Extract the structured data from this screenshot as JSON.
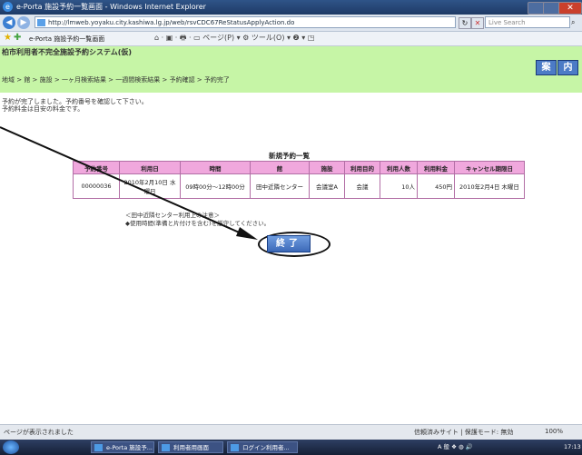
{
  "window": {
    "title": "e-Porta 施設予約一覧画面 - Windows Internet Explorer",
    "ie_icon": "e",
    "close": "✕"
  },
  "addressbar": {
    "url": "http://lmweb.yoyaku.city.kashiwa.lg.jp/web/rsvCDC67ReStatusApplyAction.do",
    "search_placeholder": "Live Search",
    "refresh": "↻",
    "stop": "✕",
    "back_icon": "◀",
    "forward_icon": "▶"
  },
  "toolbar": {
    "tab_title": "e-Porta 施設予約一覧画面",
    "home_label": "⌂ · ▣ · 🖶 · ▭ ページ(P) ▾ ⚙ ツール(O) ▾ ❷ ▾ ◳"
  },
  "page": {
    "site_title": "柏市利用者不完全施設予約システム(仮)",
    "home_button": "案",
    "guide_button": "内",
    "breadcrumb": "地域 > 館 > 施設 > 一ヶ月検索結果 > 一週間検索結果 > 予約確認 > 予約完了",
    "message_1": "予約が完了しました。予約番号を確認して下さい。",
    "message_2": "予約料金は目安の料金です。",
    "list_title": "新規予約一覧",
    "table": {
      "headers": [
        "予約番号",
        "利用日",
        "時間",
        "館",
        "施設",
        "利用目的",
        "利用人数",
        "利用料金",
        "キャンセル期限日"
      ],
      "rows": [
        [
          "00000036",
          "2010年2月10日 水曜日",
          "09時00分〜12時00分",
          "田中近隣センター",
          "会議室A",
          "会議",
          "10人",
          "450円",
          "2010年2月4日 木曜日"
        ]
      ]
    },
    "note_1": "＜田中近隣センター利用上の注意＞",
    "note_2": "◆使用時間(準備と片付けを含む)を厳守してください。",
    "finish_button": "終了"
  },
  "statusbar": {
    "status": "ページが表示されました",
    "zone": "信頼済みサイト | 保護モード: 無効",
    "zoom": "100%"
  },
  "taskbar": {
    "tasks": [
      "e-Porta 施設予...",
      "利用者用画面",
      "ログイン利用者..."
    ],
    "tray": "A 般 ❖ ◍ 🔊",
    "clock": "17:13"
  },
  "colors": {
    "banner": "#c6f5a6",
    "table_header": "#f0a8dd",
    "button_blue": "#4c7bc6"
  }
}
